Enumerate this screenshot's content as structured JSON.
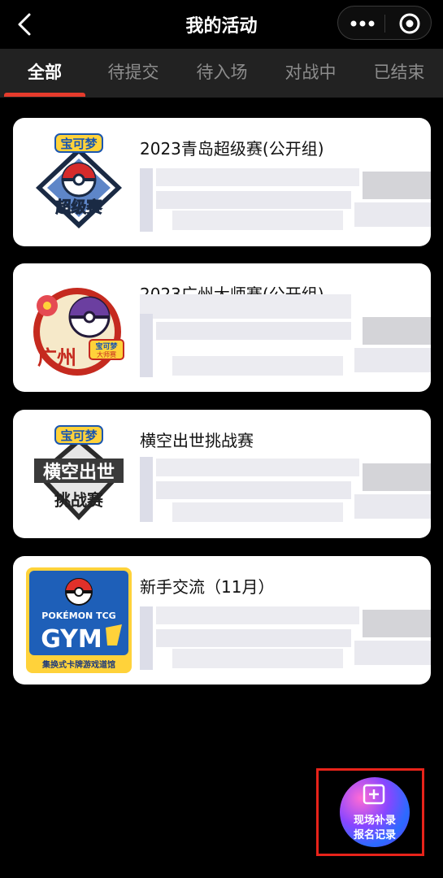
{
  "nav": {
    "title": "我的活动",
    "back_icon": "chevron-left-icon",
    "more_icon": "more-dots-icon",
    "close_icon": "target-circle-icon"
  },
  "tabs": [
    {
      "label": "全部",
      "active": true
    },
    {
      "label": "待提交",
      "active": false
    },
    {
      "label": "待入场",
      "active": false
    },
    {
      "label": "对战中",
      "active": false
    },
    {
      "label": "已结束",
      "active": false
    }
  ],
  "events": [
    {
      "name": "2023青岛超级赛(公开组)",
      "logo": {
        "top": "宝可梦",
        "main": "超级赛"
      }
    },
    {
      "name": "2023广州大师赛(公开组)",
      "logo": {
        "city": "广州",
        "badge": "宝可梦",
        "sub": "大师赛"
      }
    },
    {
      "name": "横空出世挑战赛",
      "logo": {
        "top": "宝可梦",
        "main1": "横空出世",
        "main2": "挑战赛"
      }
    },
    {
      "name": "新手交流（11月）",
      "logo": {
        "brand": "POKÉMON TCG",
        "gym": "GYM",
        "footer": "集换式卡牌游戏道馆"
      }
    }
  ],
  "fab": {
    "line1": "现场补录",
    "line2": "报名记录",
    "icon": "add-box-icon"
  },
  "colors": {
    "accent": "#e53b2c",
    "highlight_box": "#e8231a",
    "card_bg": "#ffffff",
    "tabbar_bg": "#222222"
  }
}
